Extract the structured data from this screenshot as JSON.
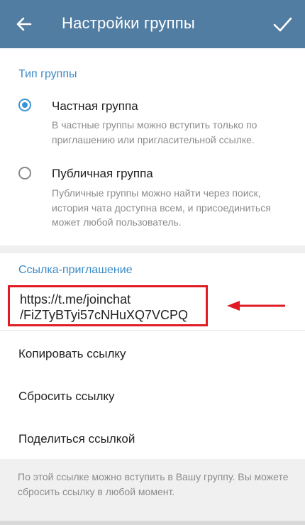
{
  "header": {
    "title": "Настройки группы",
    "back_icon": "arrow-left-icon",
    "confirm_icon": "checkmark-icon",
    "color": "#517da2"
  },
  "group_type": {
    "section_title": "Тип группы",
    "options": [
      {
        "label": "Частная группа",
        "description": "В частные группы можно вступить только по приглашению или пригласительной ссылке.",
        "selected": true
      },
      {
        "label": "Публичная группа",
        "description": "Публичные группы можно найти через поиск, история чата доступна всем, и присоединиться может любой пользователь.",
        "selected": false
      }
    ]
  },
  "invite": {
    "section_title": "Ссылка-приглашение",
    "link_line1": "https://t.me/joinchat",
    "link_line2": "/FiZTyBTyi57cNHuXQ7VCPQ",
    "actions": [
      "Копировать ссылку",
      "Сбросить ссылку",
      "Поделиться ссылкой"
    ],
    "highlight_color": "#e01b24"
  },
  "footer": {
    "text": "По этой ссылке можно вступить в Вашу группу. Вы можете сбросить ссылку в любой момент."
  },
  "accent_color": "#3a95d5"
}
